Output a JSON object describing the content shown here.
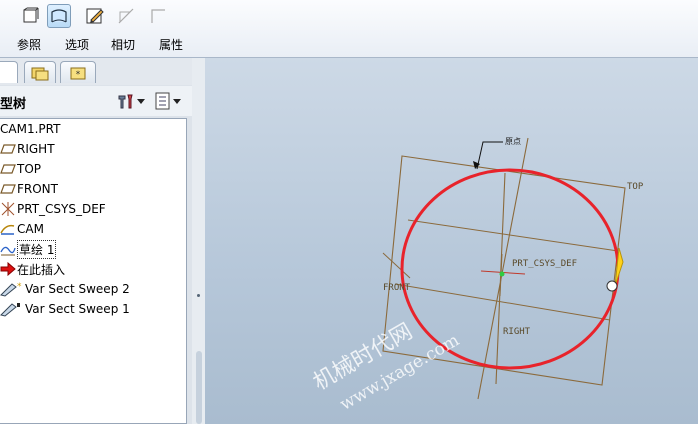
{
  "dashboard": {
    "tools": [
      {
        "name": "reference-tool",
        "active": false
      },
      {
        "name": "section-tool",
        "active": true
      },
      {
        "name": "sketch-edit-tool",
        "active": false
      },
      {
        "name": "tangent-tool",
        "active": false
      },
      {
        "name": "corner-tool",
        "active": false
      }
    ],
    "tabs": [
      "参照",
      "选项",
      "相切",
      "属性"
    ]
  },
  "navigator": {
    "title": "型树",
    "tree": [
      {
        "label": "CAM1.PRT",
        "icon": "part-icon"
      },
      {
        "label": "RIGHT",
        "icon": "datum-plane-icon"
      },
      {
        "label": "TOP",
        "icon": "datum-plane-icon"
      },
      {
        "label": "FRONT",
        "icon": "datum-plane-icon"
      },
      {
        "label": "PRT_CSYS_DEF",
        "icon": "csys-icon"
      },
      {
        "label": "CAM",
        "icon": "cam-curve-icon"
      },
      {
        "label": "草绘 1",
        "icon": "sketch-icon"
      },
      {
        "label": "在此插入",
        "icon": "insert-here-arrow-icon"
      },
      {
        "label": "Var Sect Sweep 2",
        "icon": "var-sect-sweep-icon"
      },
      {
        "label": "Var Sect Sweep 1",
        "icon": "var-sect-sweep-icon"
      }
    ]
  },
  "graphics": {
    "labels": {
      "top": "TOP",
      "front": "FRONT",
      "right": "RIGHT",
      "csys": "PRT_CSYS_DEF",
      "leader": "原点",
      "watermark_cn": "机械时代网",
      "watermark_url": "www.jxage.com"
    },
    "colors": {
      "section_circle": "#e8232b",
      "datum": "#8b6a3c",
      "watermark": "#ffffff"
    }
  }
}
